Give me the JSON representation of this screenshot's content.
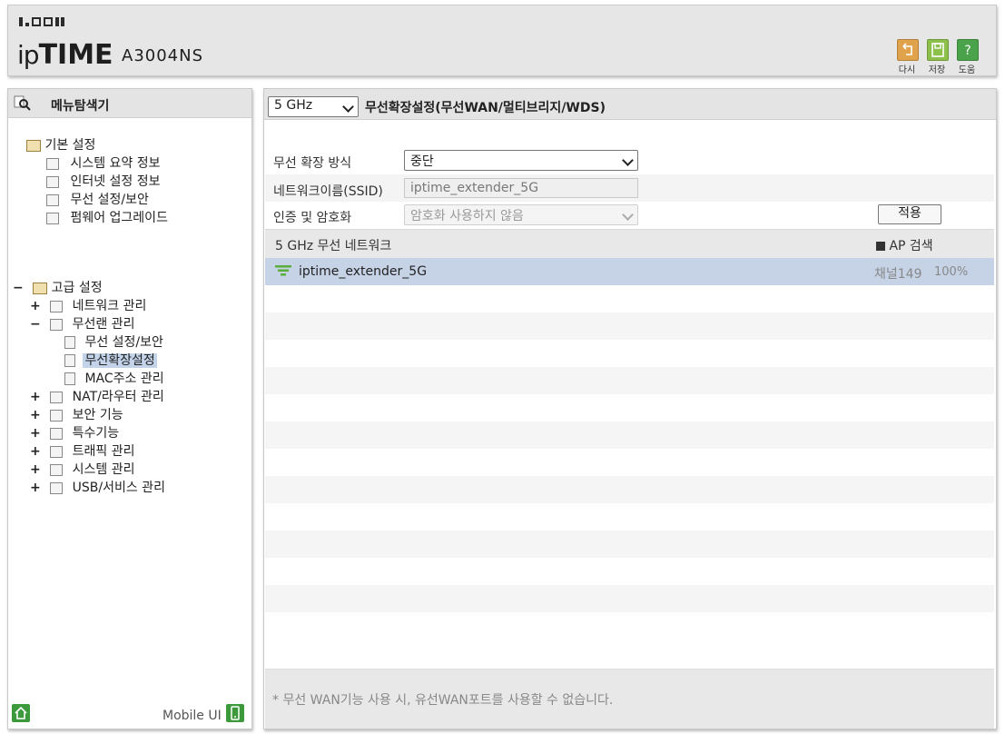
{
  "header": {
    "brand": "ipTIME",
    "model": "A3004NS",
    "buttons": [
      {
        "label": "다시",
        "icon": "undo-icon",
        "color": "#e0a24a"
      },
      {
        "label": "저장",
        "icon": "save-icon",
        "color": "#8cc04a"
      },
      {
        "label": "도움",
        "icon": "help-icon",
        "color": "#4aa34a"
      }
    ]
  },
  "sidebar": {
    "title": "메뉴탐색기",
    "basic": {
      "label": "기본 설정",
      "items": [
        "시스템 요약 정보",
        "인터넷 설정 정보",
        "무선 설정/보안",
        "펌웨어 업그레이드"
      ]
    },
    "advanced": {
      "expander": "−",
      "label": "고급 설정",
      "items": [
        {
          "expander": "+",
          "label": "네트워크 관리"
        },
        {
          "expander": "−",
          "label": "무선랜 관리",
          "children": [
            "무선 설정/보안",
            "무선확장설정",
            "MAC주소 관리"
          ]
        },
        {
          "expander": "+",
          "label": "NAT/라우터 관리"
        },
        {
          "expander": "+",
          "label": "보안 기능"
        },
        {
          "expander": "+",
          "label": "특수기능"
        },
        {
          "expander": "+",
          "label": "트래픽 관리"
        },
        {
          "expander": "+",
          "label": "시스템 관리"
        },
        {
          "expander": "+",
          "label": "USB/서비스 관리"
        }
      ],
      "selected": "무선확장설정"
    },
    "footer": {
      "mobile_label": "Mobile UI"
    }
  },
  "main": {
    "band_select": "5 GHz",
    "title": "무선확장설정(무선WAN/멀티브리지/WDS)",
    "form": {
      "mode_label": "무선 확장 방식",
      "mode_value": "중단",
      "ssid_label": "네트워크이름(SSID)",
      "ssid_value": "iptime_extender_5G",
      "auth_label": "인증 및 암호화",
      "auth_value": "암호화 사용하지 않음",
      "apply_button": "적용"
    },
    "network_list": {
      "title": "5 GHz 무선 네트워크",
      "search_button": "AP 검색",
      "rows": [
        {
          "ssid": "iptime_extender_5G",
          "channel": "채널149",
          "signal": "100%"
        }
      ]
    },
    "footnote": "* 무선 WAN기능 사용 시, 유선WAN포트를 사용할 수 없습니다."
  }
}
